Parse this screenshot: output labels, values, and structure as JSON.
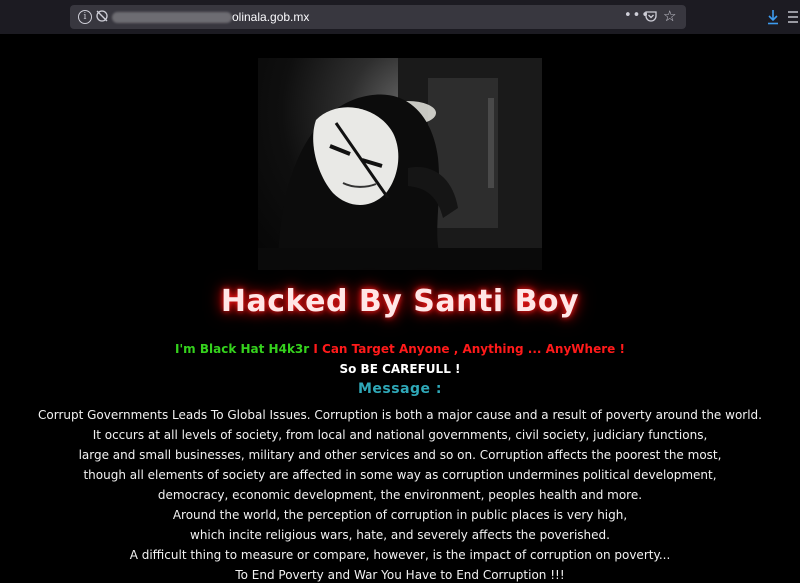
{
  "browser": {
    "url_visible": "olinala.gob.mx",
    "info_icon": "info-icon",
    "page_actions_label": "•••"
  },
  "page": {
    "headline": "Hacked By Santi Boy",
    "intro_green": "I'm Black Hat H4k3r",
    "intro_red": " I Can Target Anyone , Anything ... AnyWhere !",
    "careful": "So BE CAREFULL !",
    "message_title": "Message :",
    "message_lines": [
      "Corrupt Governments Leads To Global Issues. Corruption is both a major cause and a result of poverty around the world.",
      "It occurs at all levels of society, from local and national governments, civil society, judiciary functions,",
      "large and small businesses, military and other services and so on. Corruption affects the poorest the most,",
      "though all elements of society are affected in some way as corruption undermines political development,",
      "democracy, economic development, the environment, peoples health and more.",
      "Around the world, the perception of corruption in public places is very high,",
      "which incite religious wars, hate, and severely affects the poverished.",
      "A difficult thing to measure or compare, however, is the impact of corruption on poverty...",
      "To End Poverty and War You Have to End Corruption !!!"
    ]
  },
  "colors": {
    "green": "#35d21d",
    "red": "#ff1a1a",
    "teal": "#2fa8b8",
    "headline_glow": "#ff2020"
  }
}
